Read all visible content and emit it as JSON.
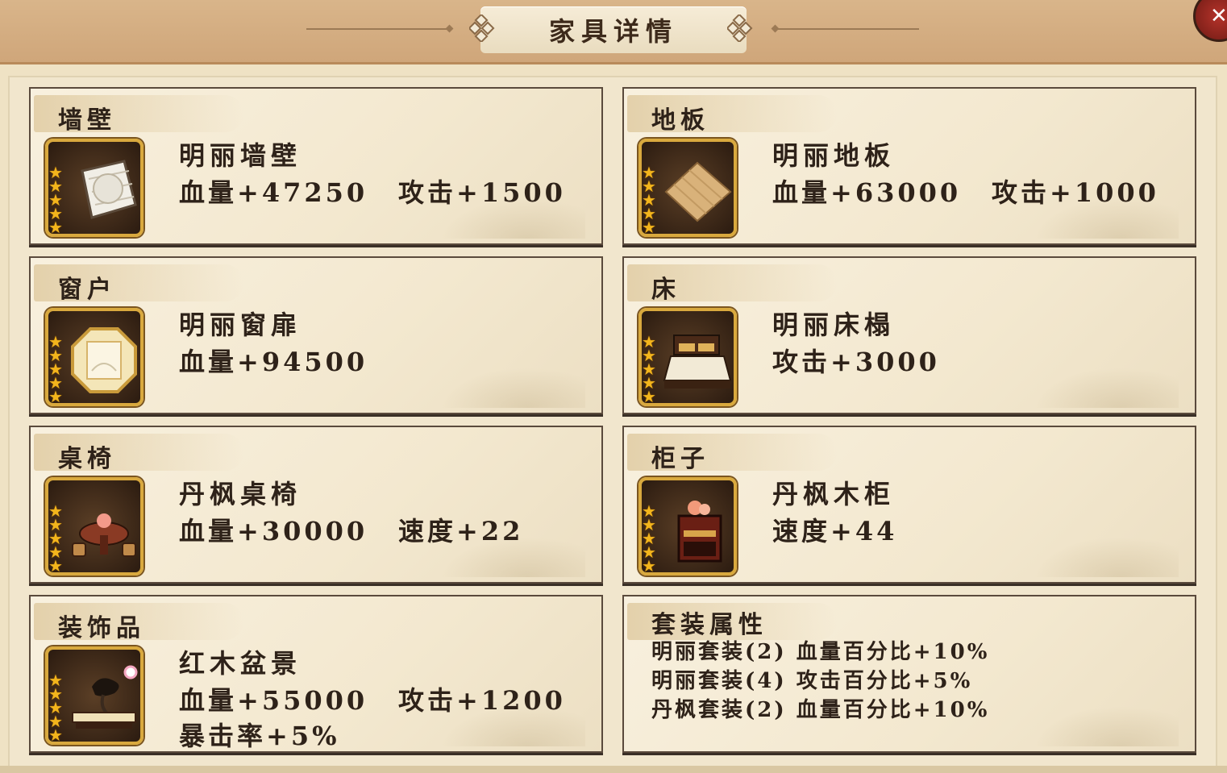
{
  "header": {
    "title": "家具详情",
    "close_label": "✕"
  },
  "slots": [
    {
      "category": "墙壁",
      "name": "明丽墙壁",
      "stats": [
        "血量+47250",
        "攻击+1500"
      ],
      "icon": "wall-icon"
    },
    {
      "category": "地板",
      "name": "明丽地板",
      "stats": [
        "血量+63000",
        "攻击+1000"
      ],
      "icon": "floor-icon"
    },
    {
      "category": "窗户",
      "name": "明丽窗扉",
      "stats": [
        "血量+94500"
      ],
      "icon": "window-icon"
    },
    {
      "category": "床",
      "name": "明丽床榻",
      "stats": [
        "攻击+3000"
      ],
      "icon": "bed-icon"
    },
    {
      "category": "桌椅",
      "name": "丹枫桌椅",
      "stats": [
        "血量+30000",
        "速度+22"
      ],
      "icon": "table-chair-icon"
    },
    {
      "category": "柜子",
      "name": "丹枫木柜",
      "stats": [
        "速度+44"
      ],
      "icon": "cabinet-icon"
    },
    {
      "category": "装饰品",
      "name": "红木盆景",
      "stats": [
        "血量+55000",
        "攻击+1200",
        "暴击率+5%"
      ],
      "icon": "bonsai-icon"
    }
  ],
  "set_bonus": {
    "title": "套装属性",
    "lines": [
      "明丽套装(2) 血量百分比+10%",
      "明丽套装(4) 攻击百分比+5%",
      "丹枫套装(2) 血量百分比+10%"
    ]
  },
  "colors": {
    "accent_gold": "#d9a93e",
    "star": "#f3b51c",
    "text": "#2e2219"
  }
}
